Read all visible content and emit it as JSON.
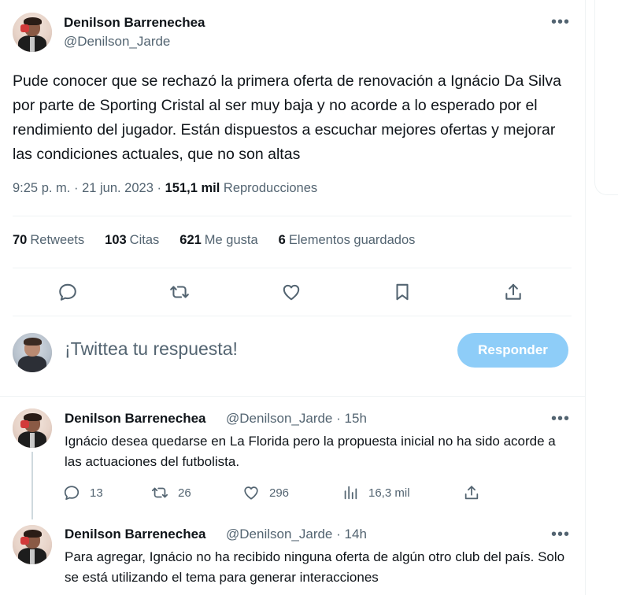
{
  "main_tweet": {
    "author_name": "Denilson Barrenechea",
    "author_handle": "@Denilson_Jarde",
    "more_icon": "more-horizontal-icon",
    "text": "Pude conocer que se rechazó la primera oferta de renovación a Ignácio Da Silva por parte de Sporting Cristal al ser muy baja y no acorde a lo esperado por el rendimiento del jugador. Están dispuestos a escuchar mejores ofertas y mejorar las condiciones actuales, que no son  altas",
    "time": "9:25 p. m.",
    "date": "21 jun. 2023",
    "views_count": "151,1 mil",
    "views_label": "Reproducciones",
    "separator": "·"
  },
  "stats": {
    "retweets": {
      "count": "70",
      "label": "Retweets"
    },
    "quotes": {
      "count": "103",
      "label": "Citas"
    },
    "likes": {
      "count": "621",
      "label": "Me gusta"
    },
    "bookmarks": {
      "count": "6",
      "label": "Elementos guardados"
    }
  },
  "actions": [
    "reply-icon",
    "retweet-icon",
    "like-icon",
    "bookmark-icon",
    "share-icon"
  ],
  "reply_composer": {
    "placeholder": "¡Twittea tu respuesta!",
    "button_label": "Responder",
    "button_color": "#8ecdf8"
  },
  "replies": [
    {
      "author_name": "Denilson Barrenechea",
      "author_handle": "@Denilson_Jarde",
      "time_ago": "15h",
      "separator": "·",
      "text": "Ignácio desea quedarse en La Florida pero la propuesta inicial no ha sido acorde a las actuaciones del futbolista.",
      "replies": "13",
      "retweets": "26",
      "likes": "296",
      "views": "16,3 mil"
    },
    {
      "author_name": "Denilson Barrenechea",
      "author_handle": "@Denilson_Jarde",
      "time_ago": "14h",
      "separator": "·",
      "text": "Para agregar, Ignácio no ha recibido ninguna oferta de algún otro club del país. Solo se está utilizando el tema para generar interacciones"
    }
  ],
  "colors": {
    "text_primary": "#0f1419",
    "text_secondary": "#536471",
    "divider": "#eff3f4",
    "thread_line": "#cfd9de"
  }
}
